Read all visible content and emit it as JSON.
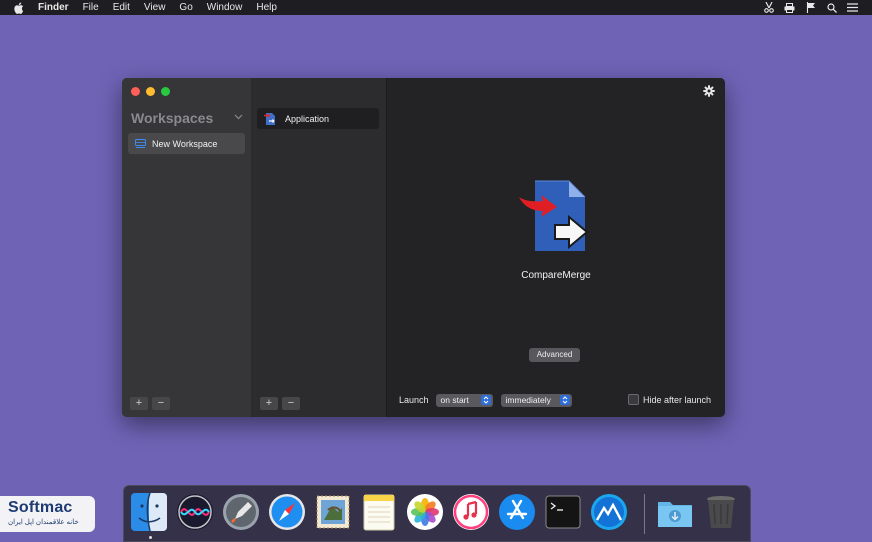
{
  "menubar": {
    "app_name": "Finder",
    "items": [
      "File",
      "Edit",
      "View",
      "Go",
      "Window",
      "Help"
    ],
    "status_icons": [
      "scissors-icon",
      "printer-icon",
      "flag-icon",
      "search-icon",
      "list-icon"
    ]
  },
  "sidebar": {
    "title": "Workspaces",
    "items": [
      {
        "label": "New Workspace"
      }
    ]
  },
  "apps_list": {
    "items": [
      {
        "label": "Application"
      }
    ]
  },
  "main": {
    "app_name": "CompareMerge",
    "advanced_label": "Advanced",
    "launch_label": "Launch",
    "launch_when": "on start",
    "launch_timing": "immediately",
    "hide_after_launch_label": "Hide after launch",
    "hide_after_launch_checked": false
  },
  "buttons": {
    "add": "+",
    "remove": "−"
  },
  "dock": {
    "apps": [
      "Finder",
      "Siri",
      "Launchpad",
      "Safari",
      "Mail",
      "Notes",
      "Photos",
      "iTunes",
      "App Store",
      "Terminal",
      "Instruments",
      "Downloads",
      "Trash"
    ]
  },
  "watermark": {
    "brand": "Softmac",
    "tagline": "خانه علاقمندان اپل ایران"
  },
  "colors": {
    "desktop": "#6f63b6",
    "window": "#222224",
    "accent": "#2f6ed8"
  }
}
